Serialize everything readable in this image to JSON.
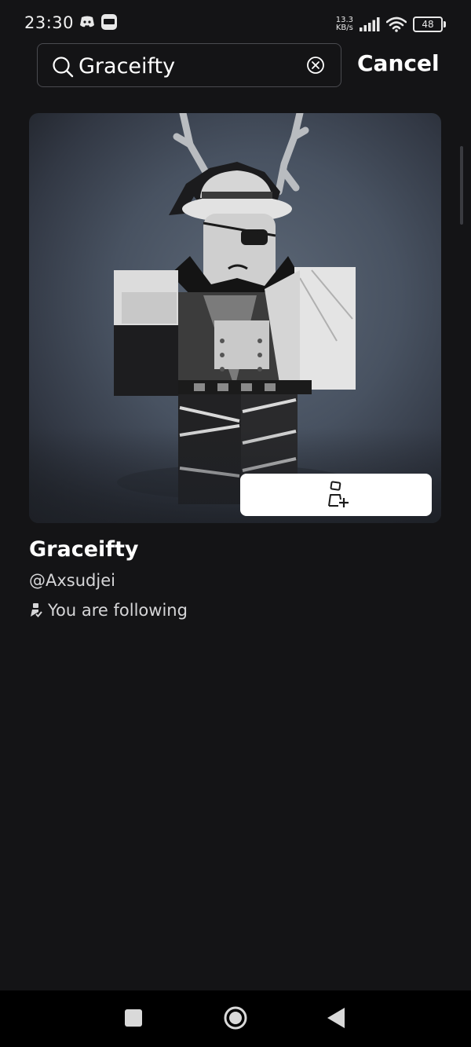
{
  "status_bar": {
    "time": "23:30",
    "net_speed_value": "13.3",
    "net_speed_unit": "KB/s",
    "battery": "48",
    "icons": [
      "discord-icon",
      "zalo-icon",
      "signal-icon",
      "wifi-icon",
      "battery-icon"
    ]
  },
  "search": {
    "query": "Graceifty",
    "cancel_label": "Cancel"
  },
  "result": {
    "display_name": "Graceifty",
    "username": "@Axsudjei",
    "following_text": "You are following",
    "follow_icon": "add-friend-icon"
  },
  "nav": {
    "icons": [
      "recents-icon",
      "home-icon",
      "back-icon"
    ]
  }
}
